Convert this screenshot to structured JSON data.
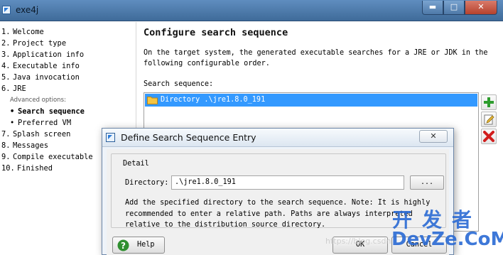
{
  "window": {
    "title": "exe4j",
    "controls": {
      "minimize": "▬",
      "maximize": "□",
      "close": "✕"
    }
  },
  "sidebar": {
    "steps": [
      {
        "num": "1.",
        "label": "Welcome"
      },
      {
        "num": "2.",
        "label": "Project type"
      },
      {
        "num": "3.",
        "label": "Application info"
      },
      {
        "num": "4.",
        "label": "Executable info"
      },
      {
        "num": "5.",
        "label": "Java invocation"
      },
      {
        "num": "6.",
        "label": "JRE"
      },
      {
        "num": "7.",
        "label": "Splash screen"
      },
      {
        "num": "8.",
        "label": "Messages"
      },
      {
        "num": "9.",
        "label": "Compile executable"
      },
      {
        "num": "10.",
        "label": "Finished"
      }
    ],
    "advanced_label": "Advanced options:",
    "sub_steps": [
      {
        "bullet": "•",
        "label": "Search sequence",
        "active": true
      },
      {
        "bullet": "•",
        "label": "Preferred VM",
        "active": false
      }
    ]
  },
  "main": {
    "title": "Configure search sequence",
    "description": "On the target system, the generated executable searches for a JRE or JDK in the following configurable order.",
    "sequence_label": "Search sequence:",
    "sequence_items": [
      {
        "label": "Directory .\\jre1.8.0_191",
        "icon": "folder-icon",
        "selected": true
      }
    ],
    "side_buttons": [
      {
        "name": "add-entry-button",
        "icon": "plus-icon"
      },
      {
        "name": "edit-entry-button",
        "icon": "edit-icon"
      },
      {
        "name": "remove-entry-button",
        "icon": "delete-icon"
      }
    ]
  },
  "dialog": {
    "title": "Define Search Sequence Entry",
    "close": "✕",
    "group_label": "Detail",
    "directory_label": "Directory:",
    "directory_value": ".\\jre1.8.0_191",
    "browse_label": "...",
    "help_text": "Add the specified directory to the search sequence. Note: It is highly recommended to enter a relative path. Paths are always interpreted relative to the distribution source directory.",
    "help_button": "Help",
    "ok_button": "OK",
    "cancel_button": "Cancel"
  },
  "watermark": {
    "line1": "开发者",
    "line2": "DevZe.CoM",
    "small": "https://blog.csdn"
  },
  "colors": {
    "selection": "#3399ff",
    "titlebar": "#4f7dae",
    "watermark": "#2a6ad4"
  }
}
